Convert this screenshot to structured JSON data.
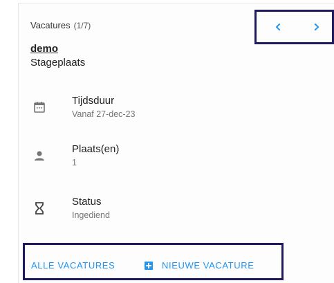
{
  "header": {
    "title": "Vacatures",
    "count": "(1/7)"
  },
  "navigation": {
    "prev_icon": "chevron-left-icon",
    "next_icon": "chevron-right-icon"
  },
  "vacancy": {
    "name": "demo",
    "type": "Stageplaats"
  },
  "details": [
    {
      "icon": "calendar-icon",
      "label": "Tijdsduur",
      "value": "Vanaf 27-dec-23"
    },
    {
      "icon": "person-icon",
      "label": "Plaats(en)",
      "value": "1"
    },
    {
      "icon": "hourglass-icon",
      "label": "Status",
      "value": "Ingediend"
    }
  ],
  "actions": {
    "all_label": "ALLE VACATURES",
    "new_label": "NIEUWE VACATURE",
    "new_icon": "add-box-icon"
  },
  "colors": {
    "accent": "#2196f3",
    "highlight_border": "#1f1a5e",
    "icon_gray": "#757575"
  }
}
